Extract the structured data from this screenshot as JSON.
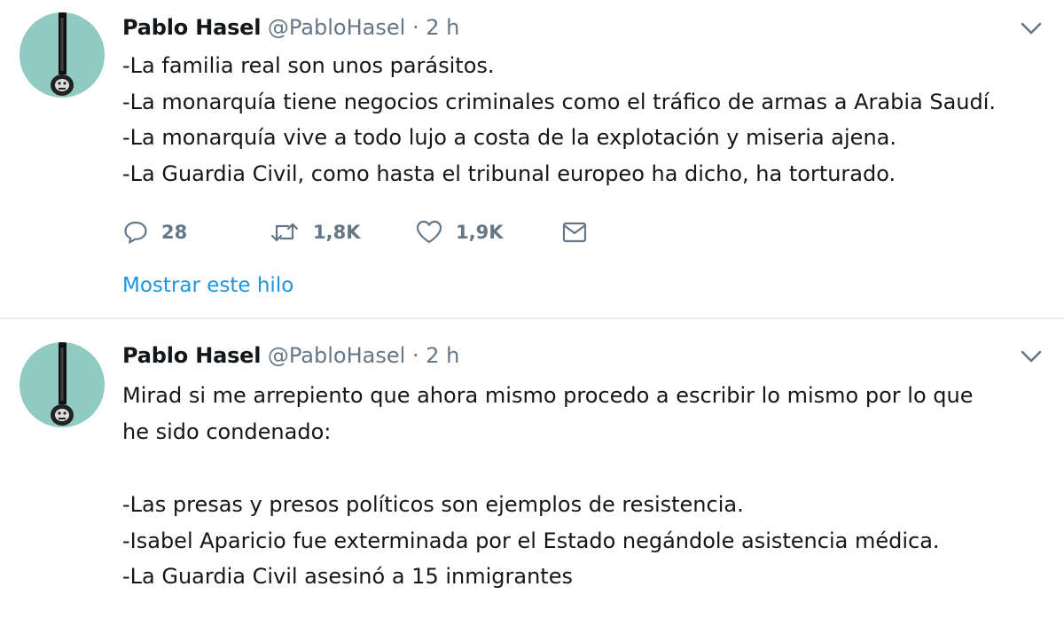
{
  "tweets": [
    {
      "author_name": "Pablo Hasel",
      "handle": "@PabloHasel",
      "separator": "·",
      "time": "2 h",
      "lines": [
        "-La familia real son unos parásitos.",
        "-La monarquía tiene negocios criminales como el tráfico de armas a Arabia Saudí.",
        "-La monarquía vive a todo lujo a costa de la explotación y miseria ajena.",
        "-La Guardia Civil, como hasta el tribunal europeo ha dicho, ha torturado."
      ],
      "replies": "28",
      "retweets": "1,8K",
      "likes": "1,9K",
      "show_thread": "Mostrar este hilo"
    },
    {
      "author_name": "Pablo Hasel",
      "handle": "@PabloHasel",
      "separator": "·",
      "time": "2 h",
      "lines": [
        "Mirad si me arrepiento que ahora mismo procedo a escribir lo mismo por lo que",
        "he sido condenado:",
        "",
        "-Las presas y presos políticos son ejemplos de resistencia.",
        "-Isabel Aparicio fue exterminada por el Estado negándole asistencia médica.",
        "-La Guardia Civil asesinó a 15 inmigrantes"
      ]
    }
  ],
  "icons": {
    "reply": "reply-icon",
    "retweet": "retweet-icon",
    "like": "heart-icon",
    "dm": "envelope-icon",
    "menu": "chevron-down-icon"
  },
  "colors": {
    "text": "#14171a",
    "secondary": "#657786",
    "link": "#1b95e0",
    "avatar_bg": "#8fcbc3",
    "divider": "#e6ecf0"
  }
}
